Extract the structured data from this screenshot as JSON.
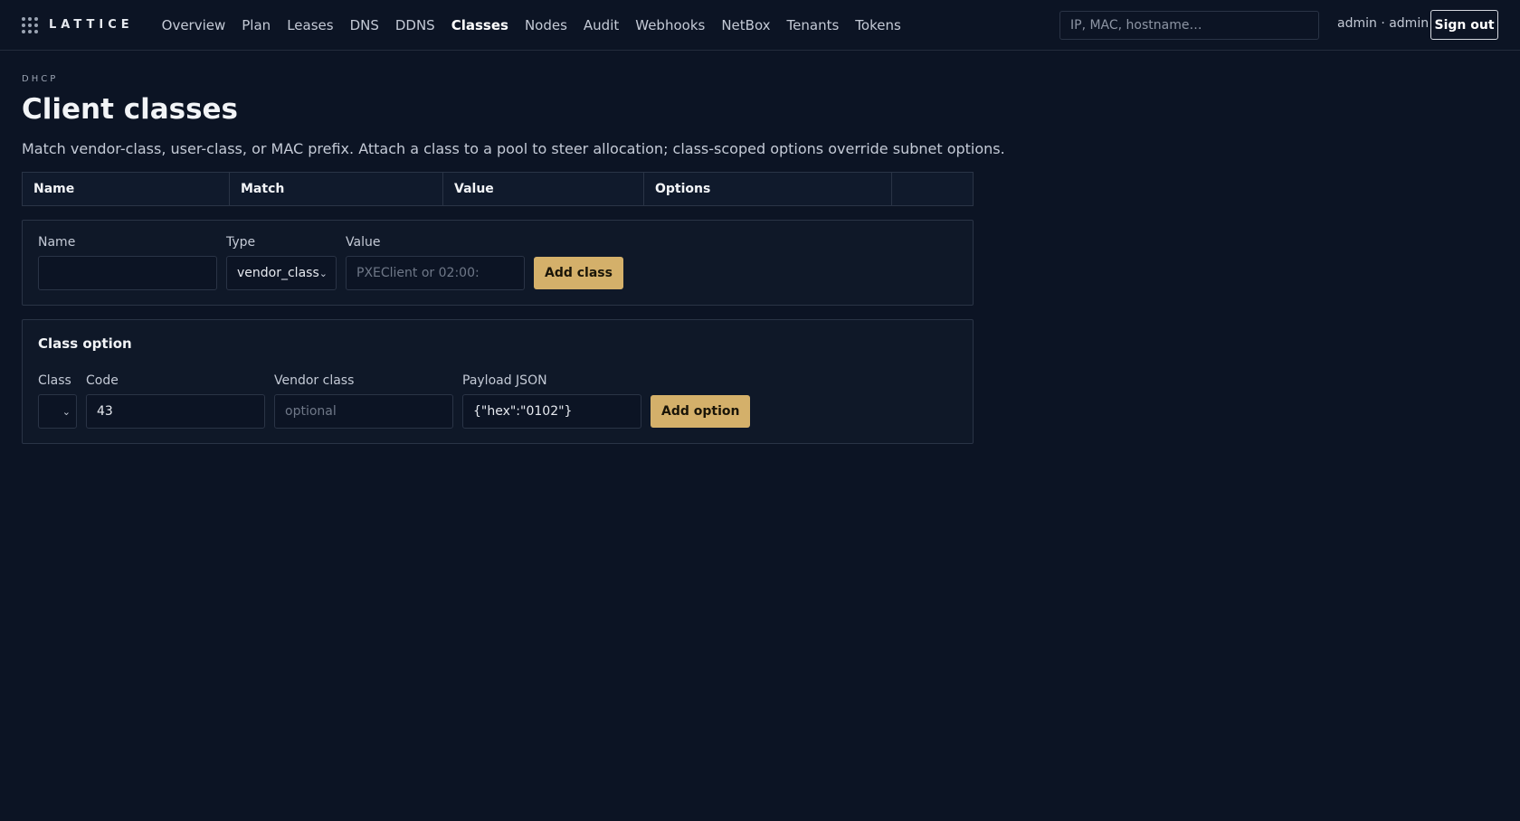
{
  "header": {
    "logo_text": "LATTICE",
    "nav": [
      {
        "label": "Overview",
        "active": false
      },
      {
        "label": "Plan",
        "active": false
      },
      {
        "label": "Leases",
        "active": false
      },
      {
        "label": "DNS",
        "active": false
      },
      {
        "label": "DDNS",
        "active": false
      },
      {
        "label": "Classes",
        "active": true
      },
      {
        "label": "Nodes",
        "active": false
      },
      {
        "label": "Audit",
        "active": false
      },
      {
        "label": "Webhooks",
        "active": false
      },
      {
        "label": "NetBox",
        "active": false
      },
      {
        "label": "Tenants",
        "active": false
      },
      {
        "label": "Tokens",
        "active": false
      }
    ],
    "search_placeholder": "IP, MAC, hostname…",
    "user": "admin · admin",
    "sign_out": "Sign out"
  },
  "page": {
    "eyebrow": "DHCP",
    "title": "Client classes",
    "description": "Match vendor-class, user-class, or MAC prefix. Attach a class to a pool to steer allocation; class-scoped options override subnet options."
  },
  "table": {
    "columns": [
      "Name",
      "Match",
      "Value",
      "Options",
      ""
    ]
  },
  "add_class_form": {
    "name_label": "Name",
    "name_value": "",
    "type_label": "Type",
    "type_value": "vendor_class",
    "value_label": "Value",
    "value_placeholder": "PXEClient or 02:00:",
    "submit": "Add class"
  },
  "class_option_form": {
    "title": "Class option",
    "class_label": "Class",
    "class_value": "",
    "code_label": "Code",
    "code_value": "43",
    "vendor_label": "Vendor class",
    "vendor_placeholder": "optional",
    "payload_label": "Payload JSON",
    "payload_value": "{\"hex\":\"0102\"}",
    "submit": "Add option"
  },
  "colors": {
    "background": "#0c1424",
    "accent": "#d4b06a",
    "border": "#2a3446"
  }
}
